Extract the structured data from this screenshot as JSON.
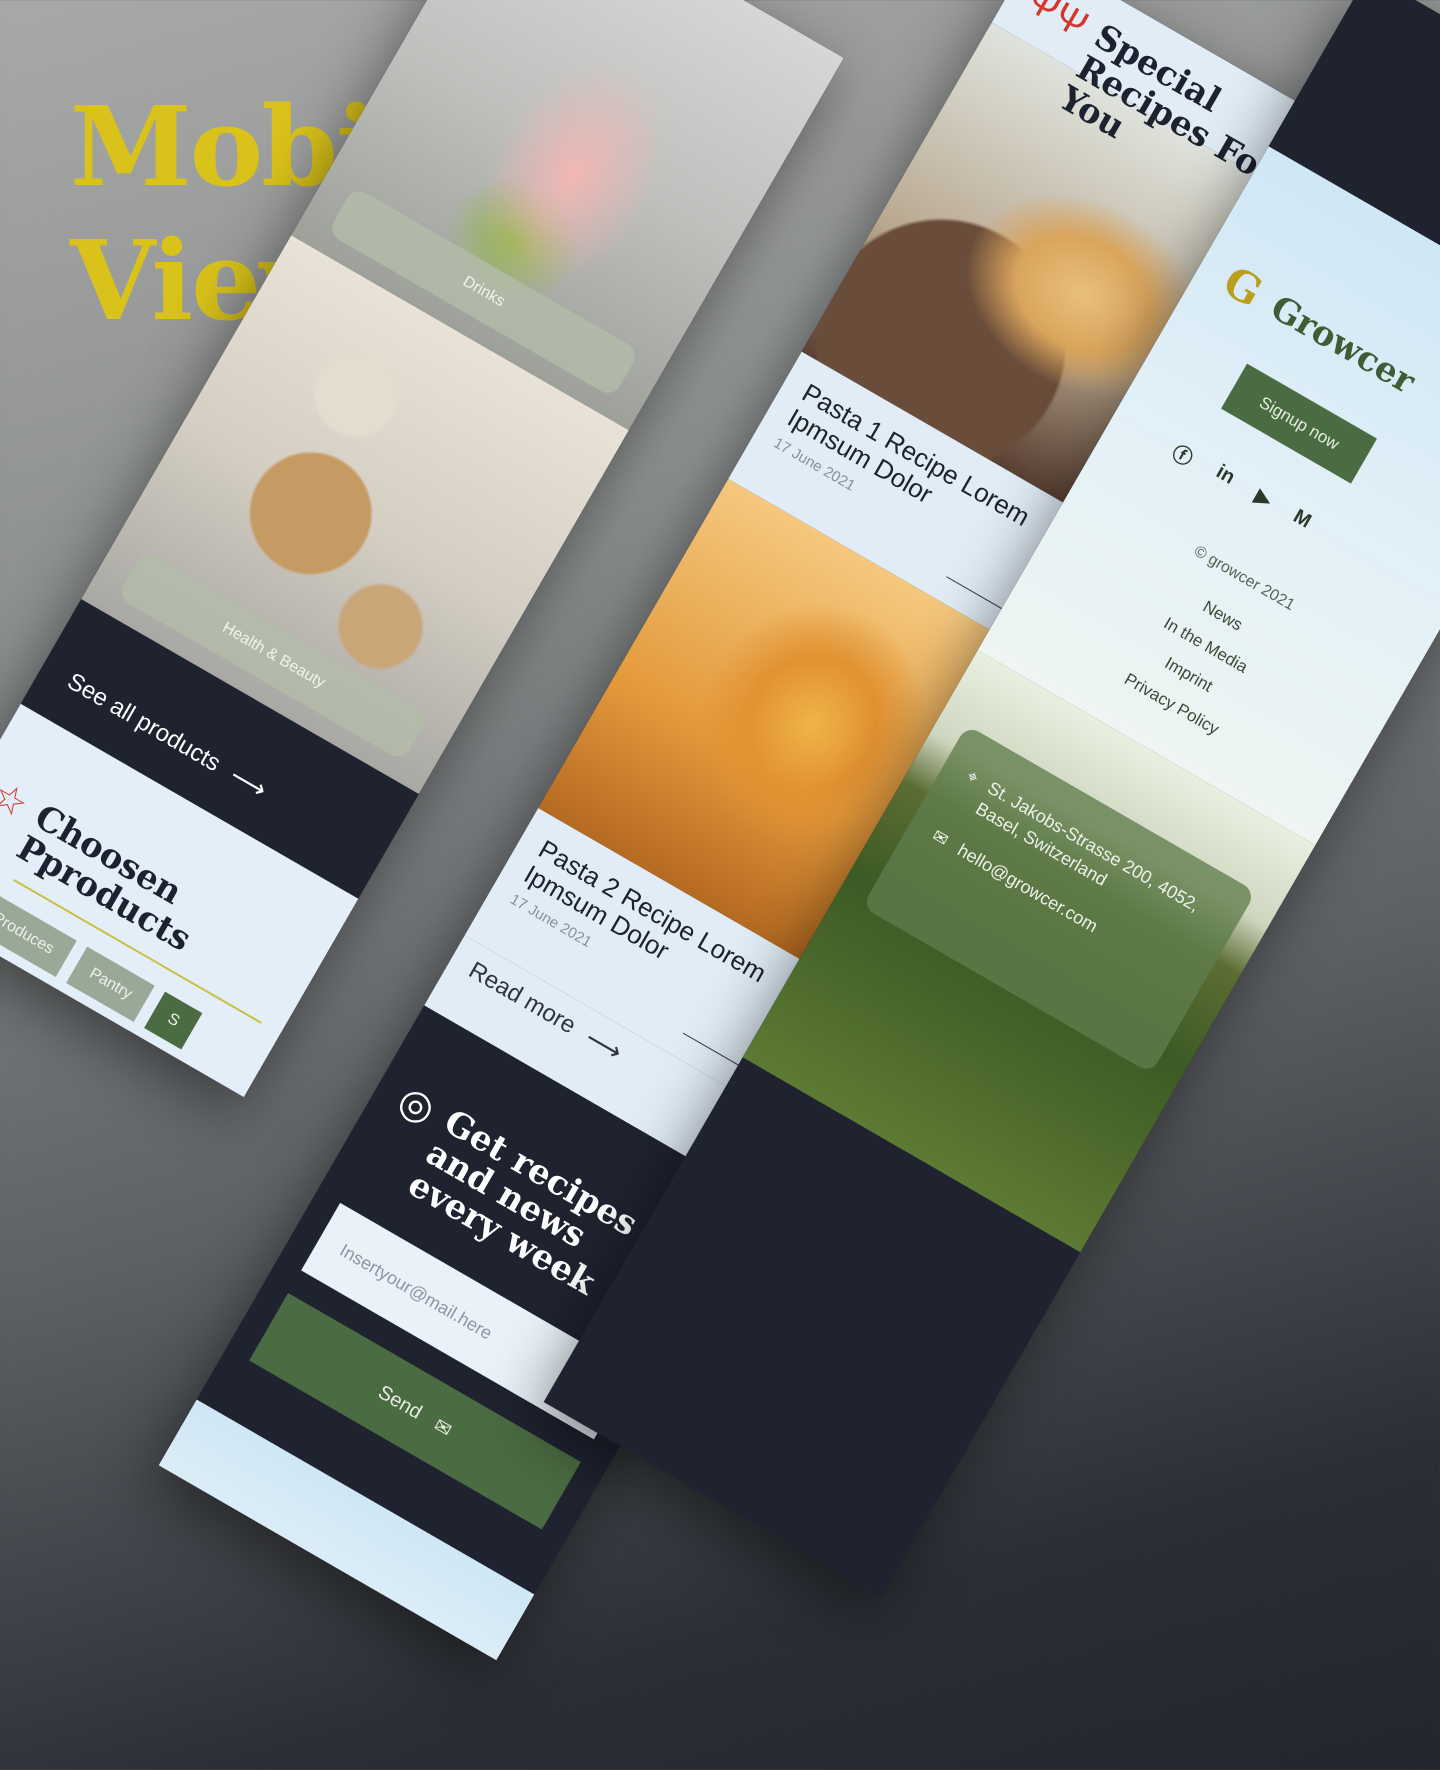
{
  "hero": {
    "line1": "Mobile",
    "line2": "View"
  },
  "products": {
    "categories": [
      {
        "label": "Drinks"
      },
      {
        "label": "Health & Beauty"
      }
    ],
    "see_all": "See all products"
  },
  "chosen": {
    "title": "Choosen Pproducts",
    "tabs": [
      "Fresh Produces",
      "Pantry",
      "S"
    ]
  },
  "recipes": {
    "title": "Special Recipes For You",
    "cards": [
      {
        "title": "Pasta 1 Recipe Lorem Ipmsum Dolor",
        "date": "17 June 2021"
      },
      {
        "title": "Pasta 2 Recipe Lorem Ipmsum Dolor",
        "date": "17 June 2021"
      }
    ],
    "read_more": "Read more"
  },
  "newsletter": {
    "title": "Get recipes and news every week",
    "placeholder": "Insertyour@mail.here",
    "send": "Send"
  },
  "footer": {
    "brand": "Growcer",
    "signup": "Signup now",
    "copyright": "© growcer 2021",
    "links": [
      "News",
      "In the Media",
      "Imprint",
      "Privacy Policy"
    ],
    "address": "St. Jakobs-Strasse 200, 4052, Basel, Switzerland",
    "email": "hello@growcer.com"
  },
  "colors": {
    "accent_yellow": "#d9c21a",
    "brand_green": "#4b6b42",
    "dark_navy": "#1f2330",
    "light_blue": "#e1ecf6"
  }
}
